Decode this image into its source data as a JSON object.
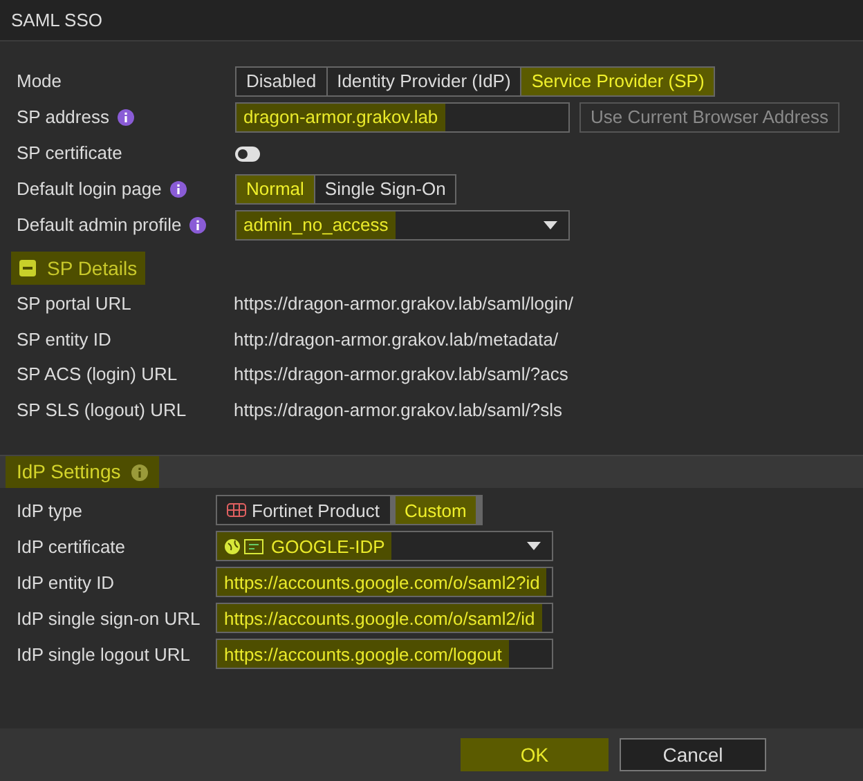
{
  "window": {
    "title": "SAML SSO"
  },
  "settings": [
    {
      "label": "Mode",
      "info": false,
      "kind": "segmented",
      "options": [
        {
          "label": "Disabled",
          "selected": false
        },
        {
          "label": "Identity Provider (IdP)",
          "selected": false
        },
        {
          "label": "Service Provider (SP)",
          "selected": true
        }
      ]
    },
    {
      "label": "SP address",
      "info": true,
      "kind": "input",
      "value": "dragon-armor.grakov.lab",
      "highlighted": true,
      "button": "Use Current Browser Address"
    },
    {
      "label": "SP certificate",
      "info": false,
      "kind": "toggle",
      "on": false
    },
    {
      "label": "Default login page",
      "info": true,
      "kind": "segmented",
      "options": [
        {
          "label": "Normal",
          "selected": true
        },
        {
          "label": "Single Sign-On",
          "selected": false
        }
      ]
    },
    {
      "label": "Default admin profile",
      "info": true,
      "kind": "select",
      "value": "admin_no_access",
      "highlighted": true
    }
  ],
  "sp_details": {
    "title": "SP Details",
    "expanded": true,
    "rows": [
      {
        "label": "SP portal URL",
        "value": "https://dragon-armor.grakov.lab/saml/login/"
      },
      {
        "label": "SP entity ID",
        "value": "http://dragon-armor.grakov.lab/metadata/"
      },
      {
        "label": "SP ACS (login) URL",
        "value": "https://dragon-armor.grakov.lab/saml/?acs"
      },
      {
        "label": "SP SLS (logout) URL",
        "value": "https://dragon-armor.grakov.lab/saml/?sls"
      }
    ]
  },
  "idp_settings": {
    "title": "IdP Settings",
    "rows": [
      {
        "label": "IdP type",
        "kind": "segmented",
        "options": [
          {
            "label": "Fortinet Product",
            "selected": false
          },
          {
            "label": "Custom",
            "selected": true
          }
        ]
      },
      {
        "label": "IdP certificate",
        "kind": "select",
        "value": "GOOGLE-IDP",
        "highlighted": true
      },
      {
        "label": "IdP entity ID",
        "kind": "input",
        "value": "https://accounts.google.com/o/saml2?id",
        "highlighted": true
      },
      {
        "label": "IdP single sign-on URL",
        "kind": "input",
        "value": "https://accounts.google.com/o/saml2/id",
        "highlighted": true
      },
      {
        "label": "IdP single logout URL",
        "kind": "input",
        "value": "https://accounts.google.com/logout",
        "highlighted": true
      }
    ]
  },
  "buttons": [
    {
      "label": "OK",
      "primary": true
    },
    {
      "label": "Cancel",
      "primary": false
    }
  ]
}
